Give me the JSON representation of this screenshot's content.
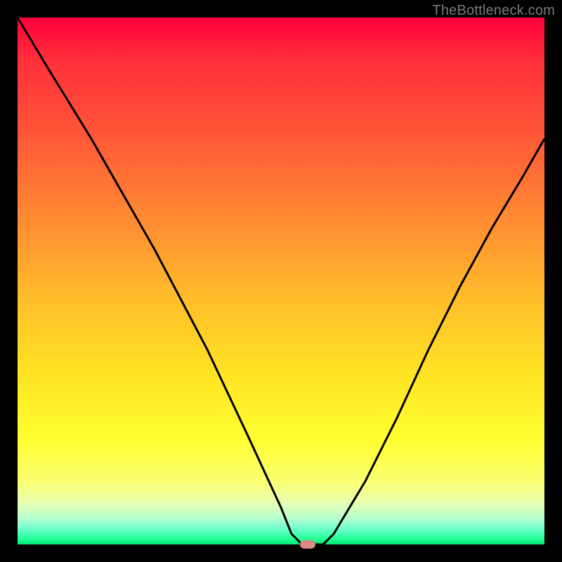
{
  "watermark": "TheBottleneck.com",
  "chart_data": {
    "type": "line",
    "title": "",
    "xlabel": "",
    "ylabel": "",
    "xlim": [
      0,
      100
    ],
    "ylim": [
      0,
      100
    ],
    "series": [
      {
        "name": "bottleneck-curve",
        "x": [
          0,
          6,
          14,
          26,
          36,
          44,
          50,
          52,
          54,
          56,
          58,
          60,
          66,
          72,
          78,
          84,
          90,
          96,
          100
        ],
        "values": [
          100,
          90,
          77,
          56,
          37,
          20,
          7,
          2,
          0,
          0,
          0,
          2,
          12,
          24,
          37,
          49,
          60,
          70,
          77
        ]
      }
    ],
    "marker": {
      "x": 55,
      "y": 0,
      "color": "#d98a84"
    },
    "colors": {
      "background_top": "#ff003a",
      "background_bottom": "#00e874",
      "curve": "#000000",
      "frame": "#000000"
    }
  }
}
